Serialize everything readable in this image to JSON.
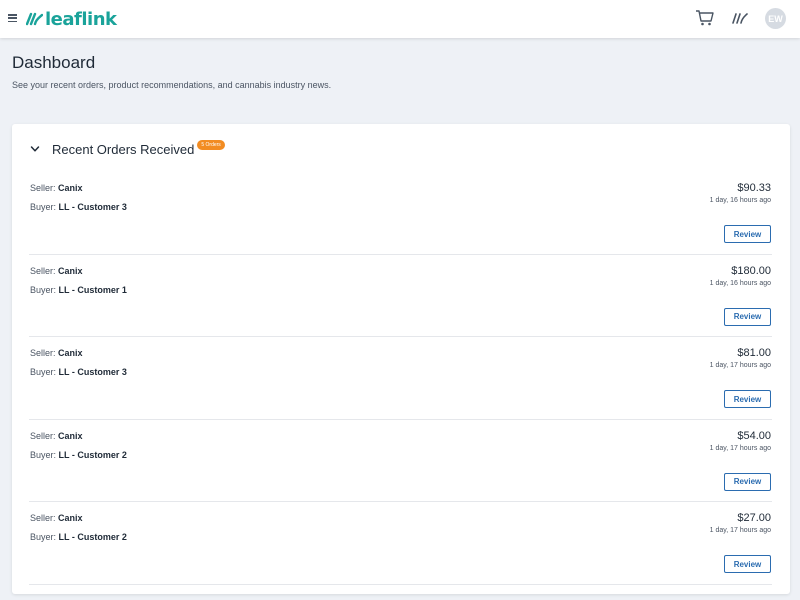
{
  "brand": {
    "name": "leaflink",
    "color": "#1aa39a"
  },
  "header": {
    "menu_icon": "hamburger-icon",
    "cart_icon": "cart-icon",
    "brand_icon": "leaflink-logo-icon",
    "avatar_initials": "EW"
  },
  "page": {
    "title": "Dashboard",
    "subtitle": "See your recent orders, product recommendations, and cannabis industry news."
  },
  "recent_orders": {
    "title": "Recent Orders Received",
    "badge": "5 Orders",
    "badge_color": "#f28c22",
    "seller_label": "Seller: ",
    "buyer_label": "Buyer: ",
    "review_label": "Review",
    "items": [
      {
        "seller": "Canix",
        "buyer": "LL - Customer 3",
        "amount": "$90.33",
        "time": "1 day, 16 hours ago"
      },
      {
        "seller": "Canix",
        "buyer": "LL - Customer 1",
        "amount": "$180.00",
        "time": "1 day, 16 hours ago"
      },
      {
        "seller": "Canix",
        "buyer": "LL - Customer 3",
        "amount": "$81.00",
        "time": "1 day, 17 hours ago"
      },
      {
        "seller": "Canix",
        "buyer": "LL - Customer 2",
        "amount": "$54.00",
        "time": "1 day, 17 hours ago"
      },
      {
        "seller": "Canix",
        "buyer": "LL - Customer 2",
        "amount": "$27.00",
        "time": "1 day, 17 hours ago"
      }
    ]
  }
}
